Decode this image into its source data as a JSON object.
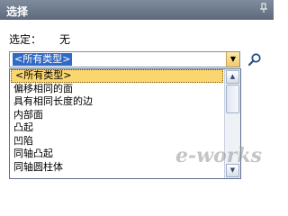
{
  "panel": {
    "title": "选择",
    "pin_icon": "pin-icon"
  },
  "selection": {
    "label": "选定：",
    "value": "无"
  },
  "type_combo": {
    "selected": "<所有类型>",
    "dropdown_icon": "chevron-down-icon"
  },
  "search": {
    "icon": "search-icon"
  },
  "dropdown": {
    "items": [
      "<所有类型>",
      "偏移相同的面",
      "具有相同长度的边",
      "内部面",
      "凸起",
      "凹陷",
      "同轴凸起",
      "同轴圆柱体"
    ],
    "selected_index": 0
  },
  "watermark": "e-works"
}
